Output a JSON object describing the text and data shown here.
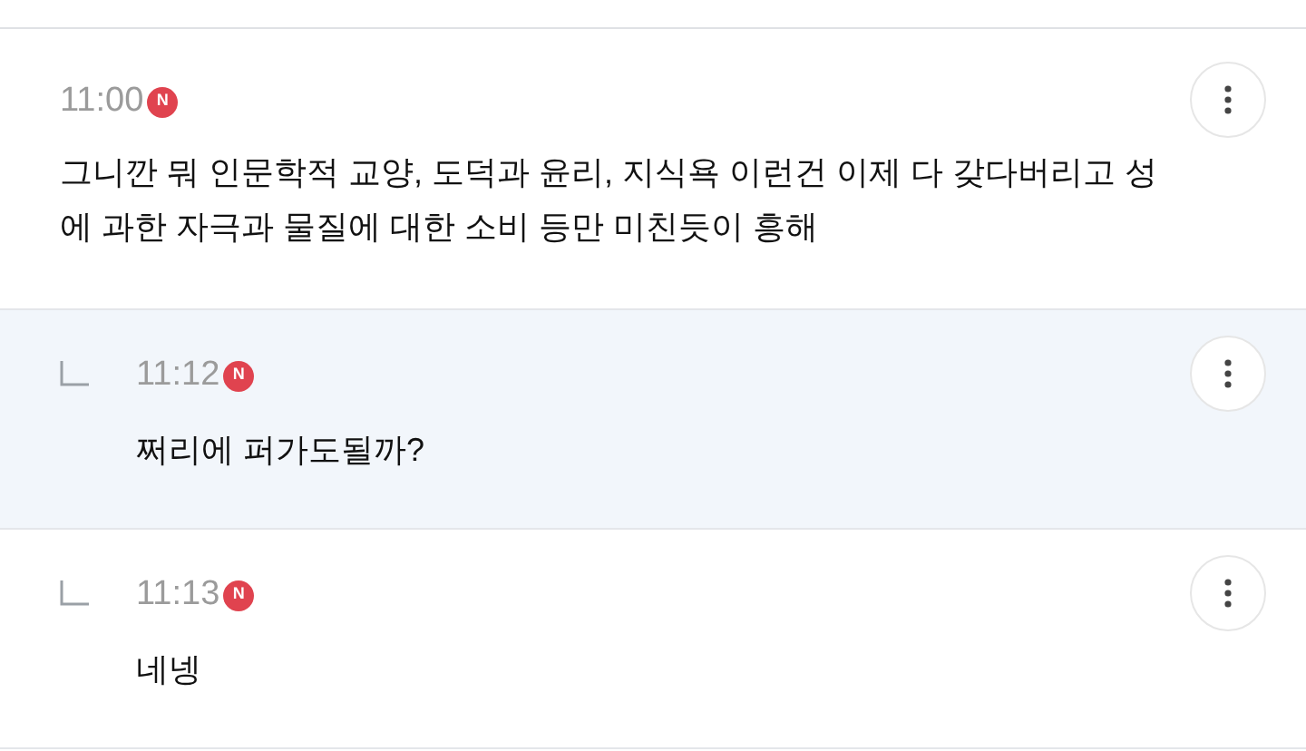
{
  "comments": [
    {
      "kind": "comment",
      "time": "11:00",
      "badge": "N",
      "text": "그니깐 뭐 인문학적 교양, 도덕과 윤리, 지식욕 이런건 이제 다 갖다버리고 성에 과한 자극과 물질에 대한 소비 등만 미친듯이 흥해",
      "highlighted": false
    },
    {
      "kind": "reply",
      "time": "11:12",
      "badge": "N",
      "text": "쩌리에 퍼가도될까?",
      "highlighted": true
    },
    {
      "kind": "reply",
      "time": "11:13",
      "badge": "N",
      "text": "네넹",
      "highlighted": false
    }
  ]
}
